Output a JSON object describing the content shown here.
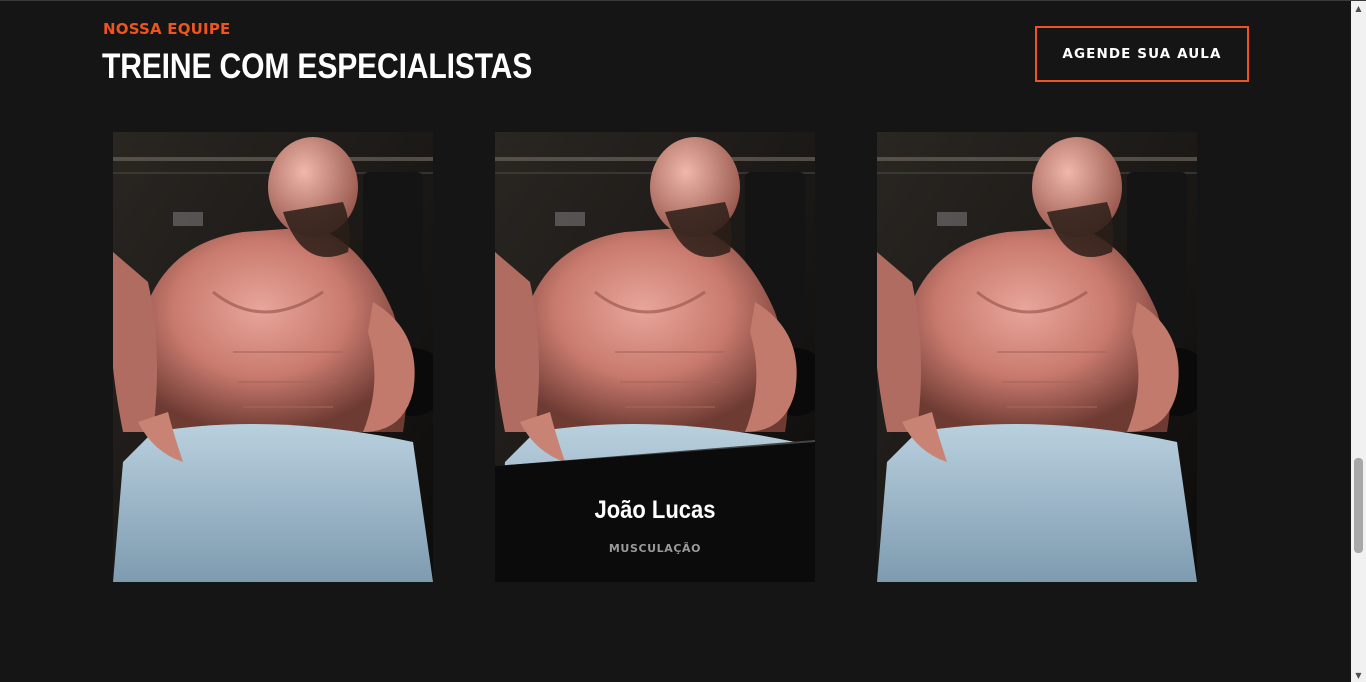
{
  "section": {
    "kicker": "NOSSA EQUIPE",
    "title": "TREINE COM ESPECIALISTAS",
    "cta_label": "AGENDE SUA AULA"
  },
  "team": [
    {
      "image": "bodybuilder-photo"
    },
    {
      "image": "bodybuilder-photo",
      "name": "João Lucas",
      "role": "MUSCULAÇÃO"
    },
    {
      "image": "bodybuilder-photo"
    }
  ],
  "colors": {
    "accent": "#f0541e",
    "background": "#151515",
    "card_info_bg": "#0b0b0b",
    "role_text": "#9a9a9a"
  },
  "scrollbar": {
    "up_icon": "scroll-up-arrow",
    "down_icon": "scroll-down-arrow"
  }
}
